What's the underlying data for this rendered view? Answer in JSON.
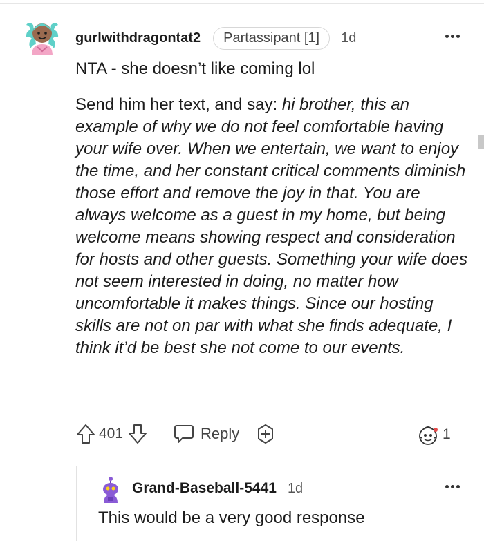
{
  "comment": {
    "username": "gurlwithdragontat2",
    "flair": "Partassipant [1]",
    "time": "1d",
    "first_line": "NTA - she doesn’t like coming lol",
    "body_plain": "Send him her text, and say: ",
    "body_italic": "hi brother, this an example of why we do not feel comfortable having your wife over. When we entertain, we want to enjoy the time, and her constant critical comments diminish those effort and remove the joy in that. You are always welcome as a guest in my home, but being welcome means showing respect and consideration for hosts and other guests. Something your wife does not seem interested in doing, no matter how uncomfortable it makes things. Since our hosting skills are not on par with what she finds adequate, I think it’d be best she not come to our events.",
    "score": "401",
    "reply_label": "Reply",
    "award_count": "1"
  },
  "reply": {
    "username": "Grand-Baseball-5441",
    "time": "1d",
    "text": "This would be a very good response"
  },
  "icons": [
    "avatar",
    "more-icon",
    "upvote-icon",
    "downvote-icon",
    "reply-icon",
    "award-icon",
    "awards-received-icon"
  ]
}
